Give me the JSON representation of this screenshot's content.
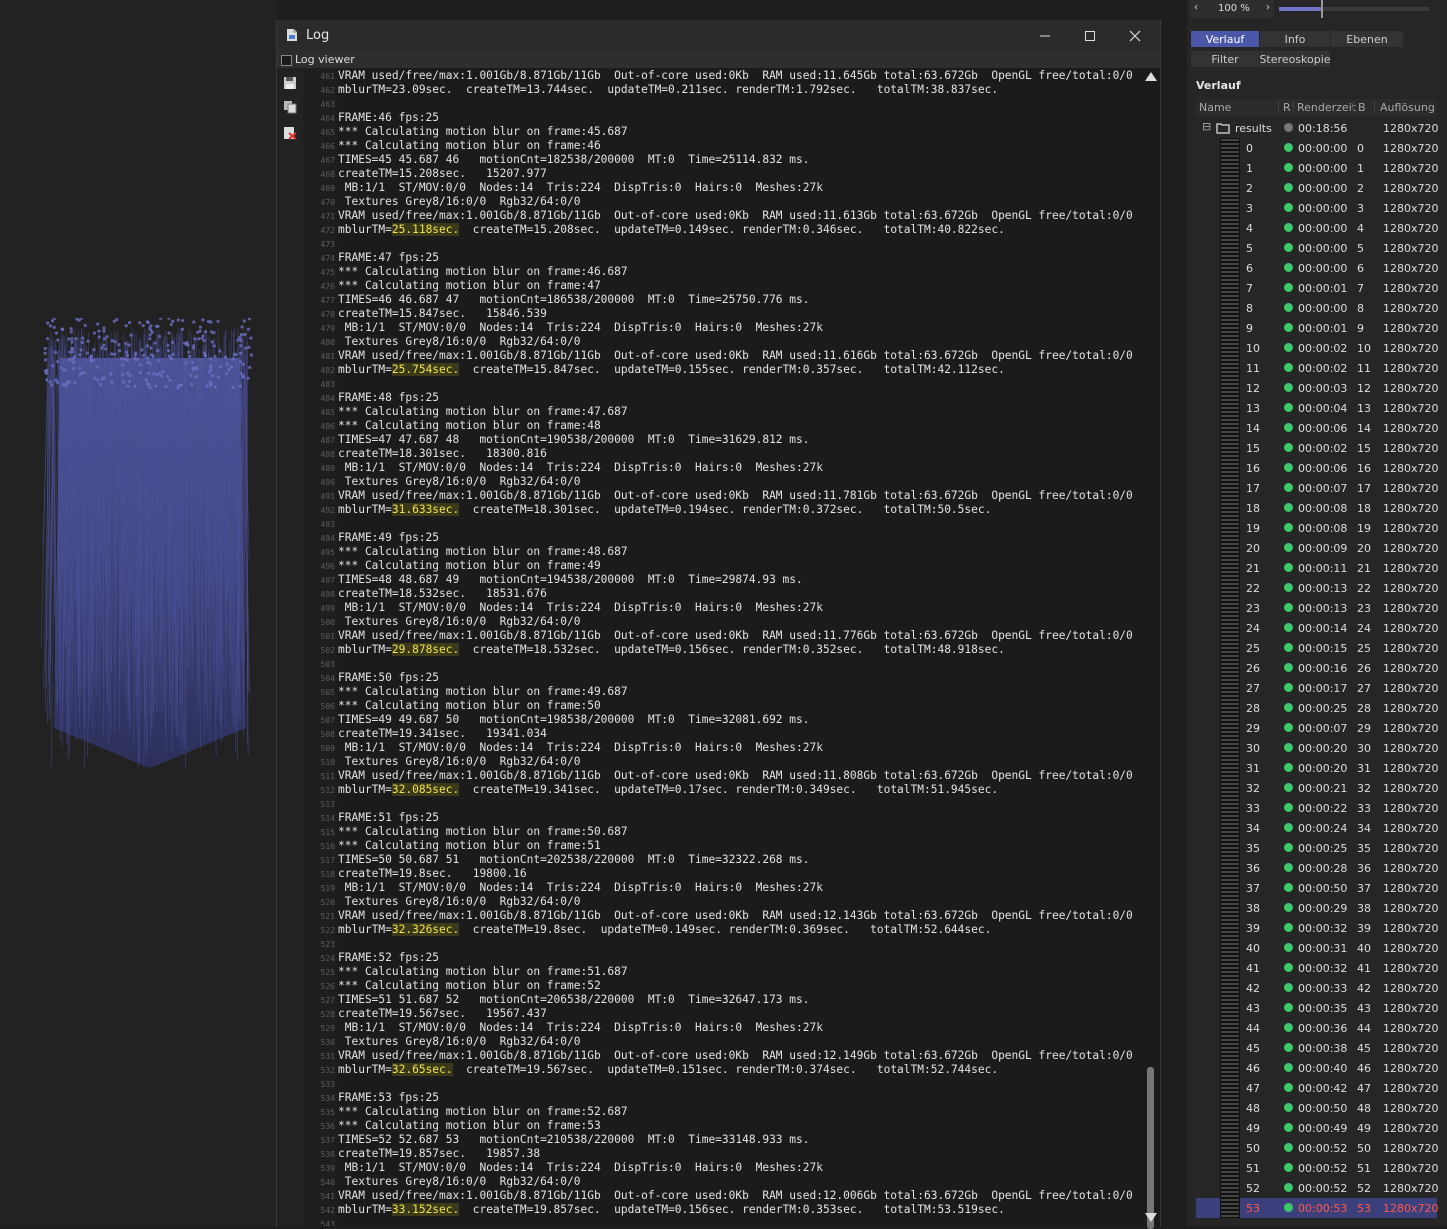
{
  "viewport": {
    "bg": "#222222",
    "fur_color": "#4a5096"
  },
  "log_window": {
    "title": "Log",
    "menu_checkbox_label": "Log viewer",
    "lines": [
      {
        "n": "461",
        "t": "VRAM used/free/max:1.001Gb/8.871Gb/11Gb  Out-of-core used:0Kb  RAM used:11.645Gb total:63.672Gb  OpenGL free/total:0/0"
      },
      {
        "n": "462",
        "t": "mblurTM=23.09sec.  createTM=13.744sec.  updateTM=0.211sec. renderTM:1.792sec.   totalTM:38.837sec."
      },
      {
        "n": "463",
        "t": ""
      },
      {
        "n": "464",
        "t": "FRAME:46 fps:25"
      },
      {
        "n": "465",
        "t": "*** Calculating motion blur on frame:45.687"
      },
      {
        "n": "466",
        "t": "*** Calculating motion blur on frame:46"
      },
      {
        "n": "467",
        "t": "TIMES=45 45.687 46   motionCnt=182538/200000  MT:0  Time=25114.832 ms."
      },
      {
        "n": "468",
        "t": "createTM=15.208sec.   15207.977"
      },
      {
        "n": "469",
        "t": " MB:1/1  ST/MOV:0/0  Nodes:14  Tris:224  DispTris:0  Hairs:0  Meshes:27k"
      },
      {
        "n": "470",
        "t": " Textures Grey8/16:0/0  Rgb32/64:0/0"
      },
      {
        "n": "471",
        "t": "VRAM used/free/max:1.001Gb/8.871Gb/11Gb  Out-of-core used:0Kb  RAM used:11.613Gb total:63.672Gb  OpenGL free/total:0/0"
      },
      {
        "n": "472",
        "p": "mblurTM=",
        "h": "25.118sec.",
        "r": "  createTM=15.208sec.  updateTM=0.149sec. renderTM:0.346sec.   totalTM:40.822sec."
      },
      {
        "n": "473",
        "t": ""
      },
      {
        "n": "474",
        "t": "FRAME:47 fps:25"
      },
      {
        "n": "475",
        "t": "*** Calculating motion blur on frame:46.687"
      },
      {
        "n": "476",
        "t": "*** Calculating motion blur on frame:47"
      },
      {
        "n": "477",
        "t": "TIMES=46 46.687 47   motionCnt=186538/200000  MT:0  Time=25750.776 ms."
      },
      {
        "n": "478",
        "t": "createTM=15.847sec.   15846.539"
      },
      {
        "n": "479",
        "t": " MB:1/1  ST/MOV:0/0  Nodes:14  Tris:224  DispTris:0  Hairs:0  Meshes:27k"
      },
      {
        "n": "480",
        "t": " Textures Grey8/16:0/0  Rgb32/64:0/0"
      },
      {
        "n": "481",
        "t": "VRAM used/free/max:1.001Gb/8.871Gb/11Gb  Out-of-core used:0Kb  RAM used:11.616Gb total:63.672Gb  OpenGL free/total:0/0"
      },
      {
        "n": "482",
        "p": "mblurTM=",
        "h": "25.754sec.",
        "r": "  createTM=15.847sec.  updateTM=0.155sec. renderTM:0.357sec.   totalTM:42.112sec."
      },
      {
        "n": "483",
        "t": ""
      },
      {
        "n": "484",
        "t": "FRAME:48 fps:25"
      },
      {
        "n": "485",
        "t": "*** Calculating motion blur on frame:47.687"
      },
      {
        "n": "486",
        "t": "*** Calculating motion blur on frame:48"
      },
      {
        "n": "487",
        "t": "TIMES=47 47.687 48   motionCnt=190538/200000  MT:0  Time=31629.812 ms."
      },
      {
        "n": "488",
        "t": "createTM=18.301sec.   18300.816"
      },
      {
        "n": "489",
        "t": " MB:1/1  ST/MOV:0/0  Nodes:14  Tris:224  DispTris:0  Hairs:0  Meshes:27k"
      },
      {
        "n": "490",
        "t": " Textures Grey8/16:0/0  Rgb32/64:0/0"
      },
      {
        "n": "491",
        "t": "VRAM used/free/max:1.001Gb/8.871Gb/11Gb  Out-of-core used:0Kb  RAM used:11.781Gb total:63.672Gb  OpenGL free/total:0/0"
      },
      {
        "n": "492",
        "p": "mblurTM=",
        "h": "31.633sec.",
        "r": "  createTM=18.301sec.  updateTM=0.194sec. renderTM:0.372sec.   totalTM:50.5sec."
      },
      {
        "n": "493",
        "t": ""
      },
      {
        "n": "494",
        "t": "FRAME:49 fps:25"
      },
      {
        "n": "495",
        "t": "*** Calculating motion blur on frame:48.687"
      },
      {
        "n": "496",
        "t": "*** Calculating motion blur on frame:49"
      },
      {
        "n": "497",
        "t": "TIMES=48 48.687 49   motionCnt=194538/200000  MT:0  Time=29874.93 ms."
      },
      {
        "n": "498",
        "t": "createTM=18.532sec.   18531.676"
      },
      {
        "n": "499",
        "t": " MB:1/1  ST/MOV:0/0  Nodes:14  Tris:224  DispTris:0  Hairs:0  Meshes:27k"
      },
      {
        "n": "500",
        "t": " Textures Grey8/16:0/0  Rgb32/64:0/0"
      },
      {
        "n": "501",
        "t": "VRAM used/free/max:1.001Gb/8.871Gb/11Gb  Out-of-core used:0Kb  RAM used:11.776Gb total:63.672Gb  OpenGL free/total:0/0"
      },
      {
        "n": "502",
        "p": "mblurTM=",
        "h": "29.878sec.",
        "r": "  createTM=18.532sec.  updateTM=0.156sec. renderTM:0.352sec.   totalTM:48.918sec."
      },
      {
        "n": "503",
        "t": ""
      },
      {
        "n": "504",
        "t": "FRAME:50 fps:25"
      },
      {
        "n": "505",
        "t": "*** Calculating motion blur on frame:49.687"
      },
      {
        "n": "506",
        "t": "*** Calculating motion blur on frame:50"
      },
      {
        "n": "507",
        "t": "TIMES=49 49.687 50   motionCnt=198538/200000  MT:0  Time=32081.692 ms."
      },
      {
        "n": "508",
        "t": "createTM=19.341sec.   19341.034"
      },
      {
        "n": "509",
        "t": " MB:1/1  ST/MOV:0/0  Nodes:14  Tris:224  DispTris:0  Hairs:0  Meshes:27k"
      },
      {
        "n": "510",
        "t": " Textures Grey8/16:0/0  Rgb32/64:0/0"
      },
      {
        "n": "511",
        "t": "VRAM used/free/max:1.001Gb/8.871Gb/11Gb  Out-of-core used:0Kb  RAM used:11.808Gb total:63.672Gb  OpenGL free/total:0/0"
      },
      {
        "n": "512",
        "p": "mblurTM=",
        "h": "32.085sec.",
        "r": "  createTM=19.341sec.  updateTM=0.17sec. renderTM:0.349sec.   totalTM:51.945sec."
      },
      {
        "n": "513",
        "t": ""
      },
      {
        "n": "514",
        "t": "FRAME:51 fps:25"
      },
      {
        "n": "515",
        "t": "*** Calculating motion blur on frame:50.687"
      },
      {
        "n": "516",
        "t": "*** Calculating motion blur on frame:51"
      },
      {
        "n": "517",
        "t": "TIMES=50 50.687 51   motionCnt=202538/220000  MT:0  Time=32322.268 ms."
      },
      {
        "n": "518",
        "t": "createTM=19.8sec.   19800.16"
      },
      {
        "n": "519",
        "t": " MB:1/1  ST/MOV:0/0  Nodes:14  Tris:224  DispTris:0  Hairs:0  Meshes:27k"
      },
      {
        "n": "520",
        "t": " Textures Grey8/16:0/0  Rgb32/64:0/0"
      },
      {
        "n": "521",
        "t": "VRAM used/free/max:1.001Gb/8.871Gb/11Gb  Out-of-core used:0Kb  RAM used:12.143Gb total:63.672Gb  OpenGL free/total:0/0"
      },
      {
        "n": "522",
        "p": "mblurTM=",
        "h": "32.326sec.",
        "r": "  createTM=19.8sec.  updateTM=0.149sec. renderTM:0.369sec.   totalTM:52.644sec."
      },
      {
        "n": "523",
        "t": ""
      },
      {
        "n": "524",
        "t": "FRAME:52 fps:25"
      },
      {
        "n": "525",
        "t": "*** Calculating motion blur on frame:51.687"
      },
      {
        "n": "526",
        "t": "*** Calculating motion blur on frame:52"
      },
      {
        "n": "527",
        "t": "TIMES=51 51.687 52   motionCnt=206538/220000  MT:0  Time=32647.173 ms."
      },
      {
        "n": "528",
        "t": "createTM=19.567sec.   19567.437"
      },
      {
        "n": "529",
        "t": " MB:1/1  ST/MOV:0/0  Nodes:14  Tris:224  DispTris:0  Hairs:0  Meshes:27k"
      },
      {
        "n": "530",
        "t": " Textures Grey8/16:0/0  Rgb32/64:0/0"
      },
      {
        "n": "531",
        "t": "VRAM used/free/max:1.001Gb/8.871Gb/11Gb  Out-of-core used:0Kb  RAM used:12.149Gb total:63.672Gb  OpenGL free/total:0/0"
      },
      {
        "n": "532",
        "p": "mblurTM=",
        "h": "32.65sec.",
        "r": "  createTM=19.567sec.  updateTM=0.151sec. renderTM:0.374sec.   totalTM:52.744sec."
      },
      {
        "n": "533",
        "t": ""
      },
      {
        "n": "534",
        "t": "FRAME:53 fps:25"
      },
      {
        "n": "535",
        "t": "*** Calculating motion blur on frame:52.687"
      },
      {
        "n": "536",
        "t": "*** Calculating motion blur on frame:53"
      },
      {
        "n": "537",
        "t": "TIMES=52 52.687 53   motionCnt=210538/220000  MT:0  Time=33148.933 ms."
      },
      {
        "n": "538",
        "t": "createTM=19.857sec.   19857.38"
      },
      {
        "n": "539",
        "t": " MB:1/1  ST/MOV:0/0  Nodes:14  Tris:224  DispTris:0  Hairs:0  Meshes:27k"
      },
      {
        "n": "540",
        "t": " Textures Grey8/16:0/0  Rgb32/64:0/0"
      },
      {
        "n": "541",
        "t": "VRAM used/free/max:1.001Gb/8.871Gb/11Gb  Out-of-core used:0Kb  RAM used:12.006Gb total:63.672Gb  OpenGL free/total:0/0"
      },
      {
        "n": "542",
        "p": "mblurTM=",
        "h": "33.152sec.",
        "r": "  createTM=19.857sec.  updateTM=0.156sec. renderTM:0.353sec.   totalTM:53.519sec."
      },
      {
        "n": "543",
        "t": ""
      }
    ]
  },
  "right_panel": {
    "zoom": {
      "value": "100 %",
      "left_arrow": "‹",
      "right_arrow": "›",
      "slider_fraction": 0.28
    },
    "tabs_row1": [
      "Verlauf",
      "Info",
      "Ebenen"
    ],
    "tabs_row2": [
      "Filter",
      "Stereoskopie"
    ],
    "section_title": "Verlauf",
    "columns": {
      "name": "Name",
      "r": "R",
      "time": "Renderzeit",
      "b": "B",
      "res": "Auflösung"
    },
    "folder": {
      "expander": "⊟",
      "name": "results",
      "time": "00:18:56",
      "res": "1280x720"
    },
    "rows": [
      {
        "name": "0",
        "time": "00:00:00",
        "b": "0",
        "res": "1280x720"
      },
      {
        "name": "1",
        "time": "00:00:00",
        "b": "1",
        "res": "1280x720"
      },
      {
        "name": "2",
        "time": "00:00:00",
        "b": "2",
        "res": "1280x720"
      },
      {
        "name": "3",
        "time": "00:00:00",
        "b": "3",
        "res": "1280x720"
      },
      {
        "name": "4",
        "time": "00:00:00",
        "b": "4",
        "res": "1280x720"
      },
      {
        "name": "5",
        "time": "00:00:00",
        "b": "5",
        "res": "1280x720"
      },
      {
        "name": "6",
        "time": "00:00:00",
        "b": "6",
        "res": "1280x720"
      },
      {
        "name": "7",
        "time": "00:00:01",
        "b": "7",
        "res": "1280x720"
      },
      {
        "name": "8",
        "time": "00:00:00",
        "b": "8",
        "res": "1280x720"
      },
      {
        "name": "9",
        "time": "00:00:01",
        "b": "9",
        "res": "1280x720"
      },
      {
        "name": "10",
        "time": "00:00:02",
        "b": "10",
        "res": "1280x720"
      },
      {
        "name": "11",
        "time": "00:00:02",
        "b": "11",
        "res": "1280x720"
      },
      {
        "name": "12",
        "time": "00:00:03",
        "b": "12",
        "res": "1280x720"
      },
      {
        "name": "13",
        "time": "00:00:04",
        "b": "13",
        "res": "1280x720"
      },
      {
        "name": "14",
        "time": "00:00:06",
        "b": "14",
        "res": "1280x720"
      },
      {
        "name": "15",
        "time": "00:00:02",
        "b": "15",
        "res": "1280x720"
      },
      {
        "name": "16",
        "time": "00:00:06",
        "b": "16",
        "res": "1280x720"
      },
      {
        "name": "17",
        "time": "00:00:07",
        "b": "17",
        "res": "1280x720"
      },
      {
        "name": "18",
        "time": "00:00:08",
        "b": "18",
        "res": "1280x720"
      },
      {
        "name": "19",
        "time": "00:00:08",
        "b": "19",
        "res": "1280x720"
      },
      {
        "name": "20",
        "time": "00:00:09",
        "b": "20",
        "res": "1280x720"
      },
      {
        "name": "21",
        "time": "00:00:11",
        "b": "21",
        "res": "1280x720"
      },
      {
        "name": "22",
        "time": "00:00:13",
        "b": "22",
        "res": "1280x720"
      },
      {
        "name": "23",
        "time": "00:00:13",
        "b": "23",
        "res": "1280x720"
      },
      {
        "name": "24",
        "time": "00:00:14",
        "b": "24",
        "res": "1280x720"
      },
      {
        "name": "25",
        "time": "00:00:15",
        "b": "25",
        "res": "1280x720"
      },
      {
        "name": "26",
        "time": "00:00:16",
        "b": "26",
        "res": "1280x720"
      },
      {
        "name": "27",
        "time": "00:00:17",
        "b": "27",
        "res": "1280x720"
      },
      {
        "name": "28",
        "time": "00:00:25",
        "b": "28",
        "res": "1280x720"
      },
      {
        "name": "29",
        "time": "00:00:07",
        "b": "29",
        "res": "1280x720"
      },
      {
        "name": "30",
        "time": "00:00:20",
        "b": "30",
        "res": "1280x720"
      },
      {
        "name": "31",
        "time": "00:00:20",
        "b": "31",
        "res": "1280x720"
      },
      {
        "name": "32",
        "time": "00:00:21",
        "b": "32",
        "res": "1280x720"
      },
      {
        "name": "33",
        "time": "00:00:22",
        "b": "33",
        "res": "1280x720"
      },
      {
        "name": "34",
        "time": "00:00:24",
        "b": "34",
        "res": "1280x720"
      },
      {
        "name": "35",
        "time": "00:00:25",
        "b": "35",
        "res": "1280x720"
      },
      {
        "name": "36",
        "time": "00:00:28",
        "b": "36",
        "res": "1280x720"
      },
      {
        "name": "37",
        "time": "00:00:50",
        "b": "37",
        "res": "1280x720"
      },
      {
        "name": "38",
        "time": "00:00:29",
        "b": "38",
        "res": "1280x720"
      },
      {
        "name": "39",
        "time": "00:00:32",
        "b": "39",
        "res": "1280x720"
      },
      {
        "name": "40",
        "time": "00:00:31",
        "b": "40",
        "res": "1280x720"
      },
      {
        "name": "41",
        "time": "00:00:32",
        "b": "41",
        "res": "1280x720"
      },
      {
        "name": "42",
        "time": "00:00:33",
        "b": "42",
        "res": "1280x720"
      },
      {
        "name": "43",
        "time": "00:00:35",
        "b": "43",
        "res": "1280x720"
      },
      {
        "name": "44",
        "time": "00:00:36",
        "b": "44",
        "res": "1280x720"
      },
      {
        "name": "45",
        "time": "00:00:38",
        "b": "45",
        "res": "1280x720"
      },
      {
        "name": "46",
        "time": "00:00:40",
        "b": "46",
        "res": "1280x720"
      },
      {
        "name": "47",
        "time": "00:00:42",
        "b": "47",
        "res": "1280x720"
      },
      {
        "name": "48",
        "time": "00:00:50",
        "b": "48",
        "res": "1280x720"
      },
      {
        "name": "49",
        "time": "00:00:49",
        "b": "49",
        "res": "1280x720"
      },
      {
        "name": "50",
        "time": "00:00:52",
        "b": "50",
        "res": "1280x720"
      },
      {
        "name": "51",
        "time": "00:00:52",
        "b": "51",
        "res": "1280x720"
      },
      {
        "name": "52",
        "time": "00:00:52",
        "b": "52",
        "res": "1280x720"
      },
      {
        "name": "53",
        "time": "00:00:53",
        "b": "53",
        "res": "1280x720",
        "selected": true
      }
    ],
    "colors": {
      "accent_tab": "#4a56a8",
      "status_green": "#3bc96a",
      "selected_row": "#3b3f7c",
      "selected_text": "#ff5a4a",
      "log_highlight": "#f2e34a"
    }
  }
}
